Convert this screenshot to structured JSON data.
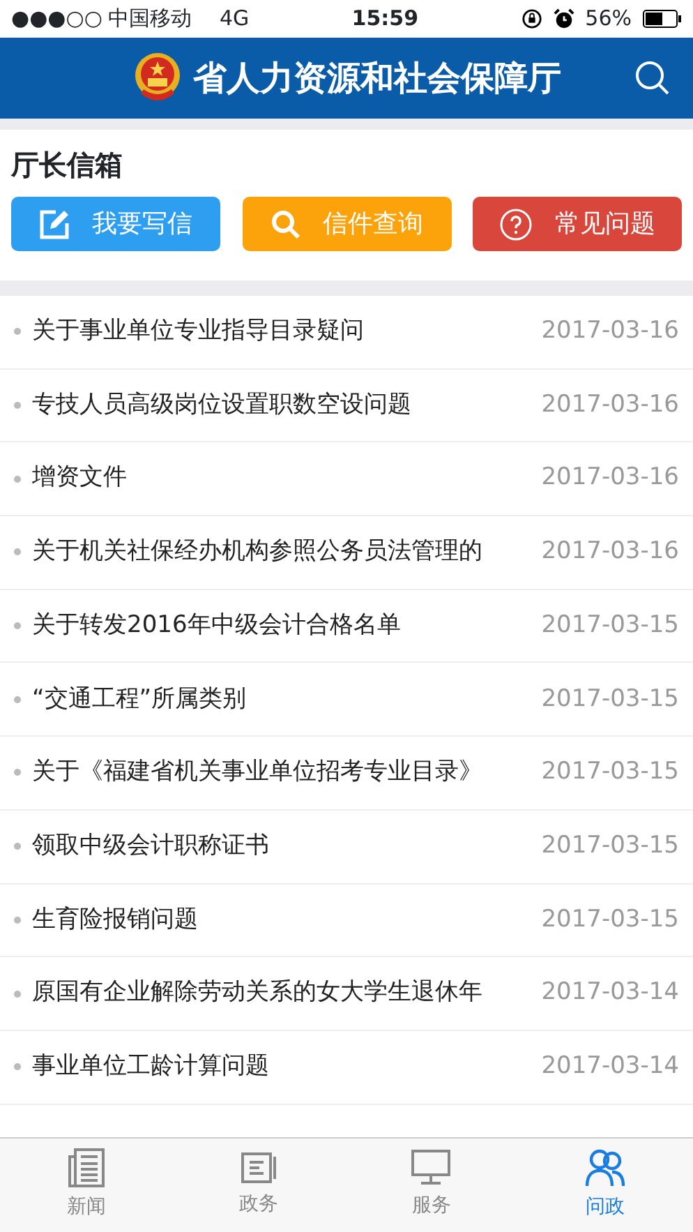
{
  "status_bar": {
    "signal": "●●●○○",
    "carrier": "中国移动",
    "network": "4G",
    "time": "15:59",
    "battery": "56%"
  },
  "header": {
    "title": "省人力资源和社会保障厅"
  },
  "section": {
    "title": "厅长信箱"
  },
  "buttons": [
    {
      "kind": "write",
      "label": "我要写信",
      "color": "#2e9ff0"
    },
    {
      "kind": "search",
      "label": "信件查询",
      "color": "#fca30c"
    },
    {
      "kind": "help",
      "label": "常见问题",
      "color": "#d9463b"
    }
  ],
  "letters": [
    {
      "title": "关于事业单位专业指导目录疑问",
      "date": "2017-03-16"
    },
    {
      "title": "专技人员高级岗位设置职数空设问题",
      "date": "2017-03-16"
    },
    {
      "title": "增资文件",
      "date": "2017-03-16"
    },
    {
      "title": "关于机关社保经办机构参照公务员法管理的",
      "date": "2017-03-16"
    },
    {
      "title": "关于转发2016年中级会计合格名单",
      "date": "2017-03-15"
    },
    {
      "title": "“交通工程”所属类别",
      "date": "2017-03-15"
    },
    {
      "title": "关于《福建省机关事业单位招考专业目录》",
      "date": "2017-03-15"
    },
    {
      "title": "领取中级会计职称证书",
      "date": "2017-03-15"
    },
    {
      "title": "生育险报销问题",
      "date": "2017-03-15"
    },
    {
      "title": "原国有企业解除劳动关系的女大学生退休年",
      "date": "2017-03-14"
    },
    {
      "title": "事业单位工龄计算问题",
      "date": "2017-03-14"
    }
  ],
  "tab_bar": [
    {
      "kind": "news",
      "label": "新闻",
      "selected": false
    },
    {
      "kind": "gov",
      "label": "政务",
      "selected": false
    },
    {
      "kind": "service",
      "label": "服务",
      "selected": false
    },
    {
      "kind": "people",
      "label": "问政",
      "selected": true
    }
  ]
}
